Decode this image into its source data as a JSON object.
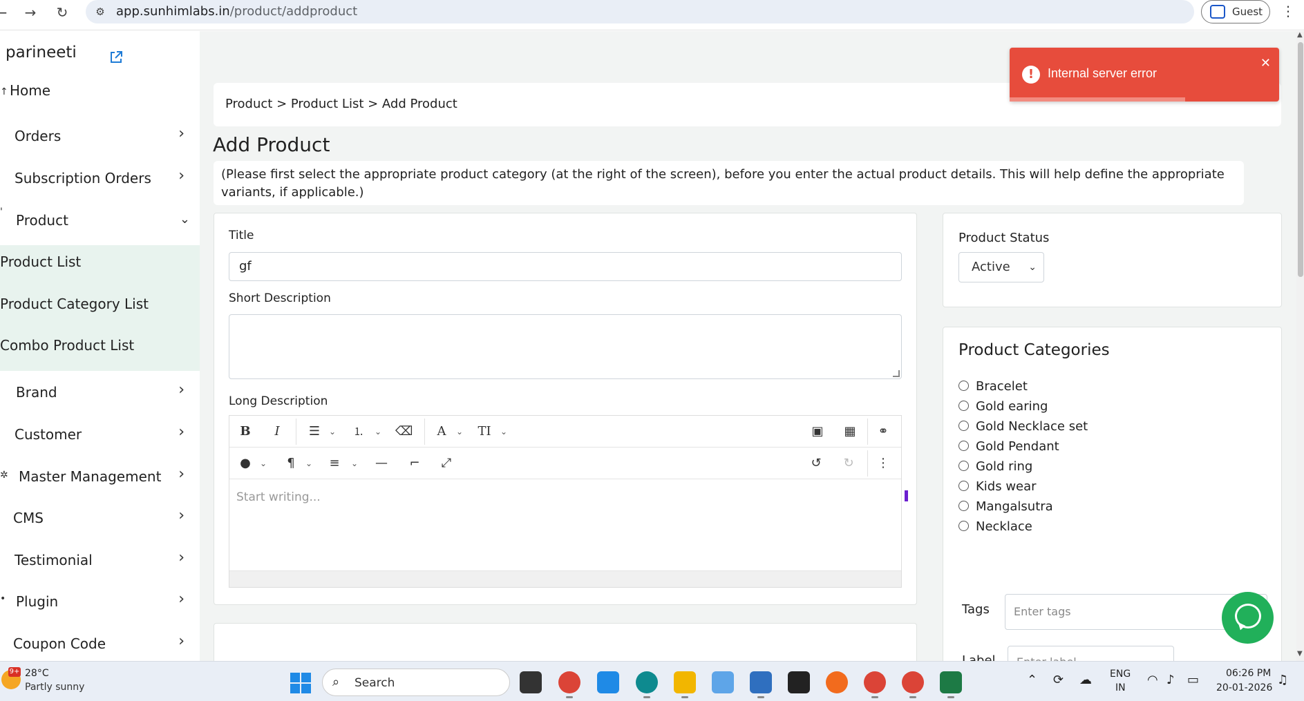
{
  "browser": {
    "url_host": "app.sunhimlabs.in",
    "url_path": "/product/addproduct",
    "profile_label": "Guest"
  },
  "sidebar": {
    "brand": "parineeti",
    "items": [
      {
        "label": "Home"
      },
      {
        "label": "Orders"
      },
      {
        "label": "Subscription Orders"
      },
      {
        "label": "Product"
      },
      {
        "label": "Brand"
      },
      {
        "label": "Customer"
      },
      {
        "label": "Master Management"
      },
      {
        "label": "CMS"
      },
      {
        "label": "Testimonial"
      },
      {
        "label": "Plugin"
      },
      {
        "label": "Coupon Code"
      }
    ],
    "product_submenu": [
      {
        "label": "Product List"
      },
      {
        "label": "Product Category List"
      },
      {
        "label": "Combo Product List"
      }
    ]
  },
  "breadcrumb": "Product > Product List > Add Product",
  "page_title": "Add Product",
  "note": "(Please first select the appropriate product category (at the right of the screen), before you enter the actual product details. This will help define the appropriate variants, if applicable.)",
  "form": {
    "title_label": "Title",
    "title_value": "gf",
    "short_desc_label": "Short Description",
    "long_desc_label": "Long Description",
    "editor_placeholder": "Start writing..."
  },
  "status": {
    "label": "Product Status",
    "selected": "Active"
  },
  "categories": {
    "title": "Product Categories",
    "options": [
      "Bracelet",
      "Gold earing",
      "Gold Necklace set",
      "Gold Pendant",
      "Gold ring",
      "Kids wear",
      "Mangalsutra",
      "Necklace"
    ],
    "tags_label": "Tags",
    "tags_placeholder": "Enter tags",
    "label_label": "Label",
    "label_placeholder": "Enter label"
  },
  "toast": {
    "message": "Internal server error",
    "progress": 0.65,
    "color": "#e74c3c"
  },
  "taskbar": {
    "weather_badge": "9+",
    "temperature": "28°C",
    "weather_desc": "Partly sunny",
    "search_label": "Search",
    "lang_top": "ENG",
    "lang_bottom": "IN",
    "time": "06:26 PM",
    "date": "20-01-2026"
  }
}
